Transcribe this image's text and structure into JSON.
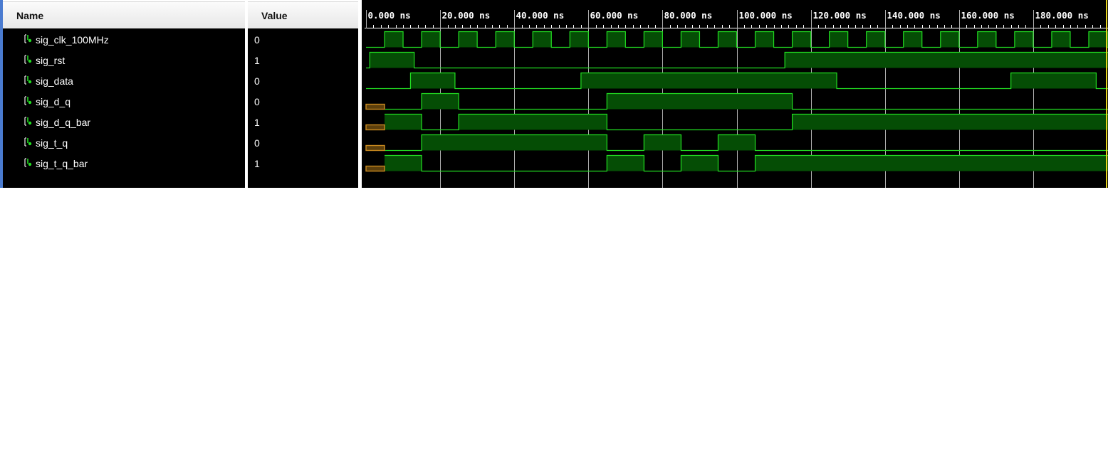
{
  "columns": {
    "name": "Name",
    "value": "Value"
  },
  "timeline": {
    "unit": "ns",
    "ticks": [
      "0.000 ns",
      "20.000 ns",
      "40.000 ns",
      "60.000 ns",
      "80.000 ns",
      "100.000 ns",
      "120.000 ns",
      "140.000 ns",
      "160.000 ns",
      "180.000 ns"
    ],
    "range_ns": [
      0,
      200
    ],
    "cursor_ns": 200
  },
  "signals": [
    {
      "name": "sig_clk_100MHz",
      "value": "0",
      "icon": "logic-signal-icon",
      "initial": "0",
      "unknown_until_ns": 0,
      "edges_ns": [
        5,
        10,
        15,
        20,
        25,
        30,
        35,
        40,
        45,
        50,
        55,
        60,
        65,
        70,
        75,
        80,
        85,
        90,
        95,
        100,
        105,
        110,
        115,
        120,
        125,
        130,
        135,
        140,
        145,
        150,
        155,
        160,
        165,
        170,
        175,
        180,
        185,
        190,
        195,
        200
      ]
    },
    {
      "name": "sig_rst",
      "value": "1",
      "icon": "logic-signal-icon",
      "initial": "0",
      "unknown_until_ns": 0,
      "edges_ns": [
        1,
        13,
        113
      ]
    },
    {
      "name": "sig_data",
      "value": "0",
      "icon": "logic-signal-icon",
      "initial": "0",
      "unknown_until_ns": 0,
      "edges_ns": [
        12,
        24,
        58,
        127,
        174,
        197
      ]
    },
    {
      "name": "sig_d_q",
      "value": "0",
      "icon": "logic-signal-icon",
      "initial": "0",
      "unknown_until_ns": 5,
      "edges_ns": [
        15,
        25,
        65,
        115
      ]
    },
    {
      "name": "sig_d_q_bar",
      "value": "1",
      "icon": "logic-signal-icon",
      "initial": "1",
      "unknown_until_ns": 5,
      "edges_ns": [
        15,
        25,
        65,
        115
      ]
    },
    {
      "name": "sig_t_q",
      "value": "0",
      "icon": "logic-signal-icon",
      "initial": "0",
      "unknown_until_ns": 5,
      "edges_ns": [
        15,
        65,
        75,
        85,
        95,
        105
      ]
    },
    {
      "name": "sig_t_q_bar",
      "value": "1",
      "icon": "logic-signal-icon",
      "initial": "1",
      "unknown_until_ns": 5,
      "edges_ns": [
        15,
        65,
        75,
        85,
        95,
        105
      ]
    }
  ],
  "colors": {
    "waveform": "#22dd22",
    "waveform_fill": "#054d05",
    "unknown": "#c8891f",
    "unknown_fill": "#5c3f0c",
    "grid": "#b0b0b0",
    "cursor": "#e6d21e",
    "background": "#000000",
    "text": "#ffffff"
  }
}
